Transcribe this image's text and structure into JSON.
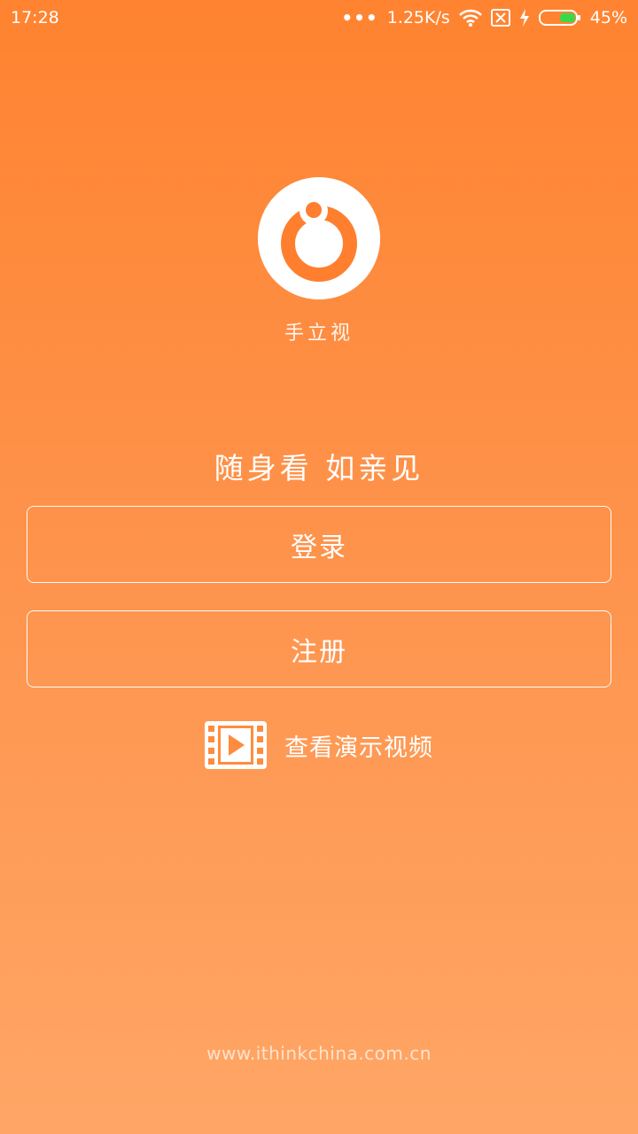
{
  "status_bar": {
    "time": "17:28",
    "network_speed": "1.25K/s",
    "battery": "45%",
    "icons": [
      "more-dots-icon",
      "wifi-icon",
      "sim-blocked-icon",
      "charging-icon",
      "battery-icon"
    ],
    "battery_level": 0.45
  },
  "app": {
    "name": "手立视",
    "slogan": "随身看 如亲见",
    "logo_icon": "app-logo-icon"
  },
  "buttons": {
    "login_label": "登录",
    "register_label": "注册"
  },
  "demo": {
    "label": "查看演示视频",
    "icon": "video-film-icon"
  },
  "footer": {
    "url": "www.ithinkchina.com.cn"
  },
  "colors": {
    "gradient_top": "#ff8330",
    "gradient_bottom": "#ffa666",
    "logo_accent": "#ff7f2e",
    "battery_fill": "#3bd84a"
  }
}
